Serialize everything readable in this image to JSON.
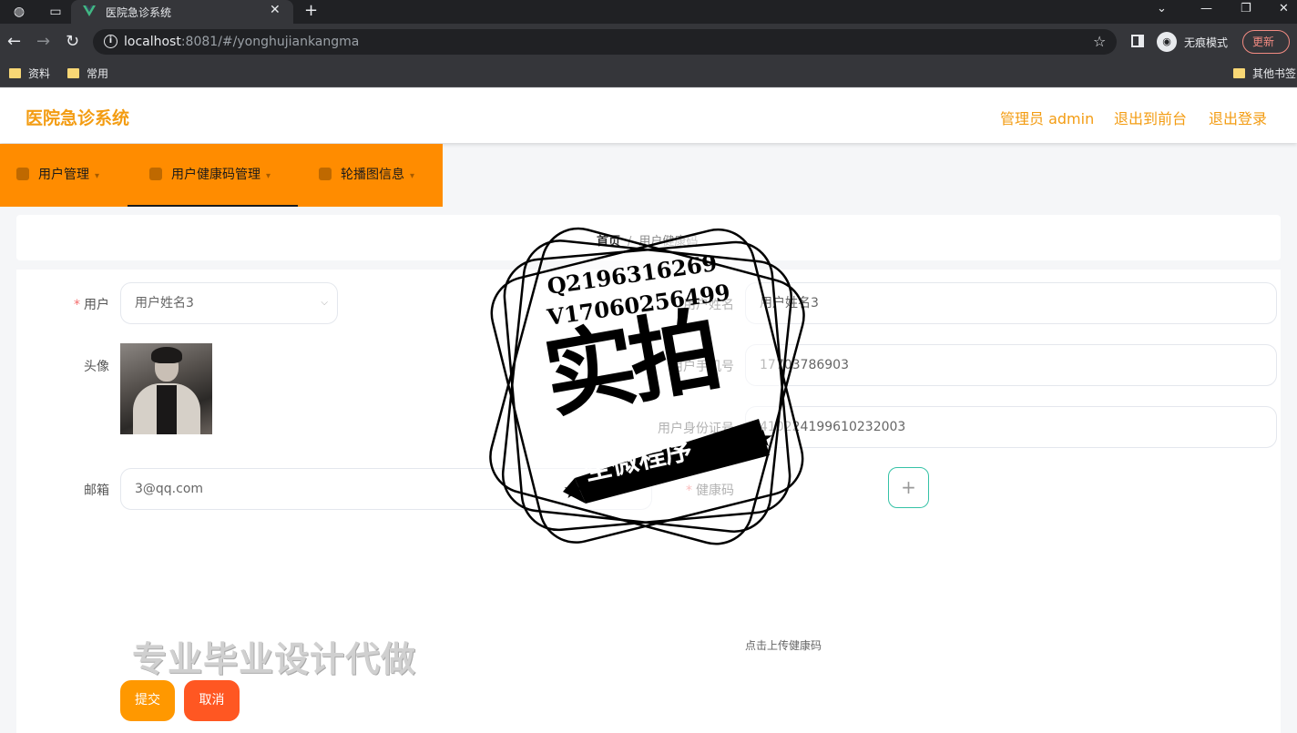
{
  "browser": {
    "tab_title": "医院急诊系统",
    "url_host": "localhost",
    "url_rest": ":8081/#/yonghujiankangma",
    "incognito_label": "无痕模式",
    "update_label": "更新",
    "bookmarks": [
      "资料",
      "常用"
    ],
    "other_bookmarks": "其他书签"
  },
  "header": {
    "title": "医院急诊系统",
    "admin": "管理员 admin",
    "back_front": "退出到前台",
    "logout": "退出登录"
  },
  "menu": {
    "items": [
      {
        "label": "用户管理"
      },
      {
        "label": "用户健康码管理"
      },
      {
        "label": "轮播图信息"
      }
    ],
    "active_index": 1
  },
  "breadcrumb": {
    "home": "首页",
    "sep": "/",
    "current": "用户健康码"
  },
  "form": {
    "user_label": "用户",
    "user_value": "用户姓名3",
    "username_label": "用户姓名",
    "username_value": "用户姓名3",
    "avatar_label": "头像",
    "phone_label": "用户手机号",
    "phone_value": "17703786903",
    "idcard_label": "用户身份证号",
    "idcard_value": "410224199610232003",
    "email_label": "邮箱",
    "email_value": "3@qq.com",
    "healthcode_label": "健康码",
    "upload_hint": "点击上传健康码",
    "submit": "提交",
    "cancel": "取消"
  },
  "overlay": {
    "ad_text": "专业毕业设计代做",
    "stamp_qq": "Q2196316269",
    "stamp_vx": "V17060256499",
    "stamp_big": "实拍",
    "stamp_banner": "全微程序"
  },
  "colors": {
    "accent": "#ff8c00",
    "title": "#f39c12",
    "submit": "#ff9800",
    "cancel": "#ff5722"
  }
}
